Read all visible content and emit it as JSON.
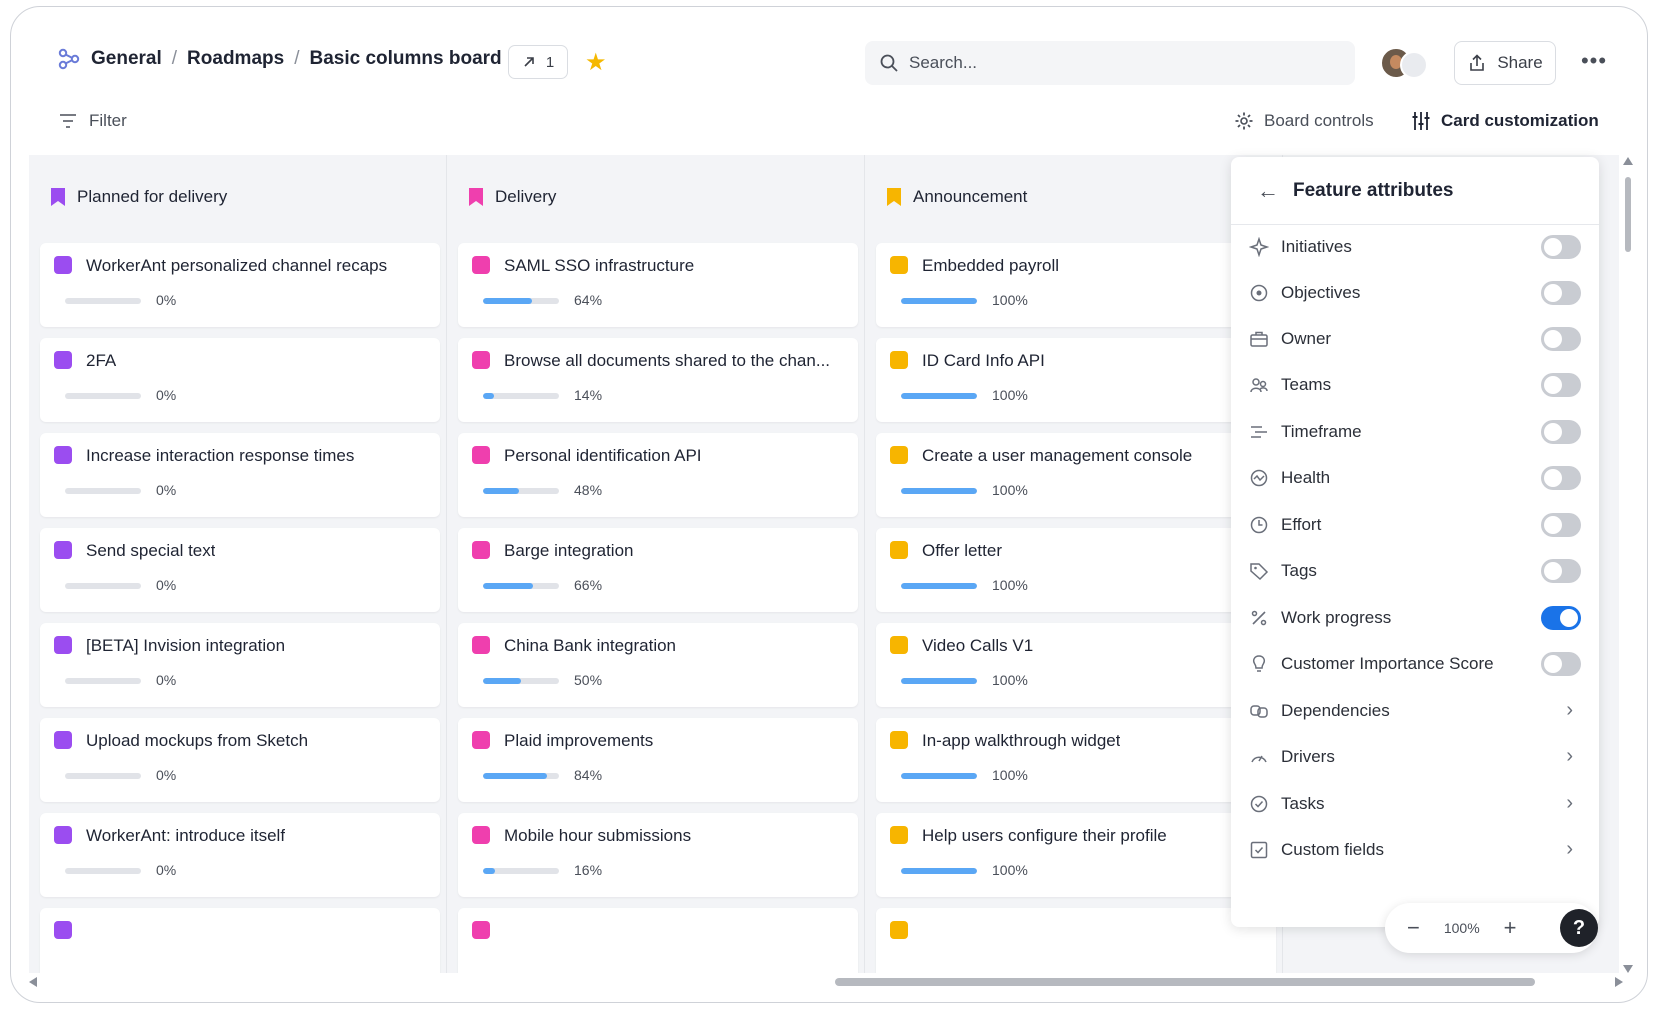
{
  "breadcrumb": {
    "root": "General",
    "section": "Roadmaps",
    "current": "Basic columns board",
    "sep": "/"
  },
  "link_count": "1",
  "search": {
    "placeholder": "Search..."
  },
  "share_label": "Share",
  "more_label": "•••",
  "filter_label": "Filter",
  "board_controls_label": "Board controls",
  "card_customization_label": "Card customization",
  "columns": [
    {
      "title": "Planned for delivery",
      "color": "#9b4df0",
      "cards": [
        {
          "title": "WorkerAnt personalized channel recaps",
          "progress": 0,
          "pct": "0%"
        },
        {
          "title": "2FA",
          "progress": 0,
          "pct": "0%"
        },
        {
          "title": "Increase interaction response times",
          "progress": 0,
          "pct": "0%"
        },
        {
          "title": "Send special text",
          "progress": 0,
          "pct": "0%"
        },
        {
          "title": "[BETA] Invision integration",
          "progress": 0,
          "pct": "0%"
        },
        {
          "title": "Upload mockups from Sketch",
          "progress": 0,
          "pct": "0%"
        },
        {
          "title": "WorkerAnt: introduce itself",
          "progress": 0,
          "pct": "0%"
        }
      ]
    },
    {
      "title": "Delivery",
      "color": "#ef3fae",
      "cards": [
        {
          "title": "SAML SSO infrastructure",
          "progress": 64,
          "pct": "64%"
        },
        {
          "title": "Browse all documents shared to the chan...",
          "progress": 14,
          "pct": "14%"
        },
        {
          "title": "Personal identification API",
          "progress": 48,
          "pct": "48%"
        },
        {
          "title": "Barge integration",
          "progress": 66,
          "pct": "66%"
        },
        {
          "title": "China Bank integration",
          "progress": 50,
          "pct": "50%"
        },
        {
          "title": "Plaid improvements",
          "progress": 84,
          "pct": "84%"
        },
        {
          "title": "Mobile hour submissions",
          "progress": 16,
          "pct": "16%"
        }
      ]
    },
    {
      "title": "Announcement",
      "color": "#f7b500",
      "cards": [
        {
          "title": "Embedded payroll",
          "progress": 100,
          "pct": "100%"
        },
        {
          "title": "ID Card Info API",
          "progress": 100,
          "pct": "100%"
        },
        {
          "title": "Create a user management console",
          "progress": 100,
          "pct": "100%"
        },
        {
          "title": "Offer letter",
          "progress": 100,
          "pct": "100%"
        },
        {
          "title": "Video Calls V1",
          "progress": 100,
          "pct": "100%"
        },
        {
          "title": "In-app walkthrough widget",
          "progress": 100,
          "pct": "100%"
        },
        {
          "title": "Help users configure their profile",
          "progress": 100,
          "pct": "100%"
        }
      ]
    }
  ],
  "panel": {
    "title": "Feature attributes",
    "attributes": [
      {
        "label": "Initiatives",
        "icon": "diamond-icon",
        "type": "toggle",
        "on": false
      },
      {
        "label": "Objectives",
        "icon": "target-icon",
        "type": "toggle",
        "on": false
      },
      {
        "label": "Owner",
        "icon": "briefcase-icon",
        "type": "toggle",
        "on": false
      },
      {
        "label": "Teams",
        "icon": "teams-icon",
        "type": "toggle",
        "on": false
      },
      {
        "label": "Timeframe",
        "icon": "timeframe-icon",
        "type": "toggle",
        "on": false
      },
      {
        "label": "Health",
        "icon": "health-icon",
        "type": "toggle",
        "on": false
      },
      {
        "label": "Effort",
        "icon": "clock-icon",
        "type": "toggle",
        "on": false
      },
      {
        "label": "Tags",
        "icon": "tag-icon",
        "type": "toggle",
        "on": false
      },
      {
        "label": "Work progress",
        "icon": "percent-icon",
        "type": "toggle",
        "on": true
      },
      {
        "label": "Customer Importance Score",
        "icon": "lightbulb-icon",
        "type": "toggle",
        "on": false
      },
      {
        "label": "Dependencies",
        "icon": "link-icon",
        "type": "chevron"
      },
      {
        "label": "Drivers",
        "icon": "gauge-icon",
        "type": "chevron"
      },
      {
        "label": "Tasks",
        "icon": "check-circle-icon",
        "type": "chevron"
      },
      {
        "label": "Custom fields",
        "icon": "checkbox-icon",
        "type": "chevron"
      }
    ]
  },
  "zoom": {
    "level": "100%",
    "minus": "−",
    "plus": "+"
  },
  "help_label": "?",
  "colors": {
    "accent": "#1a73e8",
    "progress": "#5aa7f5",
    "star": "#f5b800"
  }
}
